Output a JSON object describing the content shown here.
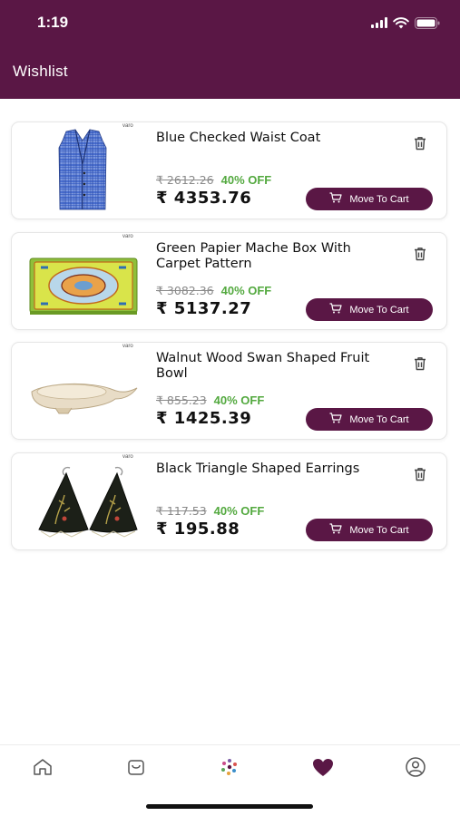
{
  "status_bar": {
    "time": "1:19"
  },
  "header": {
    "title": "Wishlist",
    "color": "#5a1745"
  },
  "wishlist": [
    {
      "name": "Blue Checked Waist Coat",
      "old_price": "₹ 2612.26",
      "discount": "40% OFF",
      "price": "₹ 4353.76",
      "cart_label": "Move To Cart",
      "logo": "varo"
    },
    {
      "name": "Green Papier Mache Box With Carpet Pattern",
      "old_price": "₹ 3082.36",
      "discount": "40% OFF",
      "price": "₹ 5137.27",
      "cart_label": "Move To Cart",
      "logo": "varo"
    },
    {
      "name": "Walnut Wood Swan Shaped Fruit Bowl",
      "old_price": "₹ 855.23",
      "discount": "40% OFF",
      "price": "₹ 1425.39",
      "cart_label": "Move To Cart",
      "logo": "varo"
    },
    {
      "name": "Black Triangle Shaped Earrings",
      "old_price": "₹ 117.53",
      "discount": "40% OFF",
      "price": "₹ 195.88",
      "cart_label": "Move To Cart",
      "logo": "varo"
    }
  ],
  "bottom_nav": {
    "items": [
      "home-icon",
      "bag-icon",
      "brand-icon",
      "heart-icon",
      "profile-icon"
    ],
    "active": "heart-icon"
  },
  "colors": {
    "accent": "#5a1745",
    "discount": "#53a93f"
  }
}
